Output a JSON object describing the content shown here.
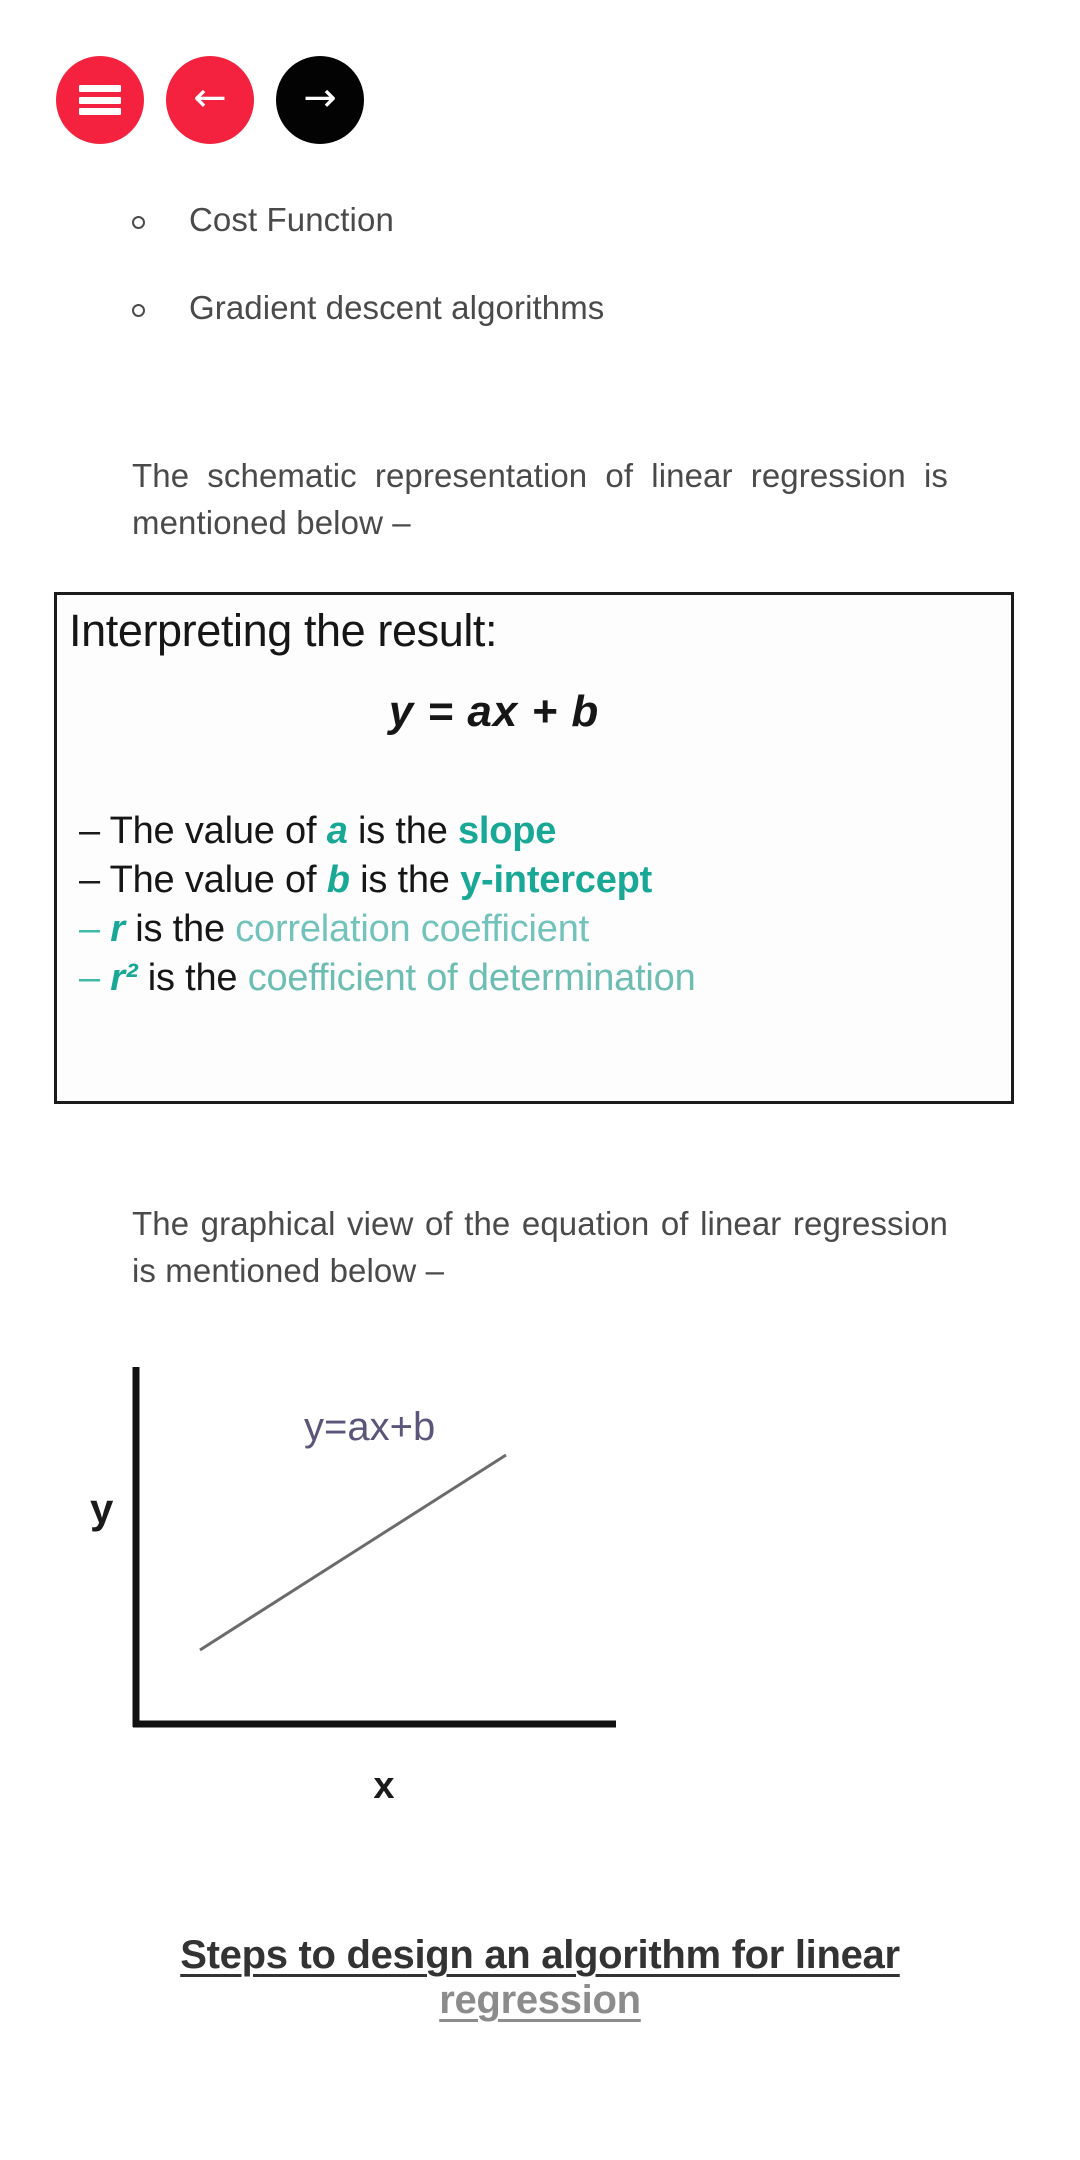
{
  "nav": {
    "buttons": [
      {
        "name": "menu-button",
        "icon": "hamburger-icon",
        "label": "",
        "color": "#f4213f"
      },
      {
        "name": "back-button",
        "icon": "arrow-left-icon",
        "label": "←",
        "color": "#f4213f"
      },
      {
        "name": "forward-button",
        "icon": "arrow-right-icon",
        "label": "→",
        "color": "#030303"
      }
    ]
  },
  "list": {
    "items": [
      {
        "text": "Cost Function"
      },
      {
        "text": "Gradient descent algorithms"
      }
    ]
  },
  "paragraphs": {
    "schematic": {
      "line1": "The schematic representation of linear",
      "line2": "regression is mentioned below –"
    },
    "graphical": {
      "line1": "The graphical view of the equation of linear",
      "line2": "regression is mentioned below –"
    }
  },
  "figure_interpreting": {
    "title": "Interpreting the result:",
    "equation": "y = ax + b",
    "lines": [
      {
        "dash": "–",
        "pre": "The value of ",
        "var": "a",
        "mid": " is the ",
        "emph": "slope",
        "emph_style": "strong"
      },
      {
        "dash": "–",
        "pre": "The value of ",
        "var": "b",
        "mid": " is the ",
        "emph": "y-intercept",
        "emph_style": "strong"
      },
      {
        "dash": "–",
        "pre": "",
        "var": "r",
        "mid": " is the ",
        "emph": "correlation coefficient",
        "emph_style": "soft"
      },
      {
        "dash": "–",
        "pre": "",
        "var": "r²",
        "mid": " is the ",
        "emph": "coefficient of determination",
        "emph_style": "soft"
      }
    ],
    "colors": {
      "teal_strong": "#1aa896",
      "teal_soft": "#73c2bb",
      "text": "#161616",
      "border": "#1b1b1b"
    }
  },
  "figure_graph": {
    "y_axis_label": "y",
    "x_axis_label": "x",
    "annotation": "y=ax+b",
    "annotation_color": "#5b557a",
    "axis_color": "#111111",
    "line_color": "#6b6b6b"
  },
  "chart_data": {
    "type": "line",
    "title": "",
    "xlabel": "x",
    "ylabel": "y",
    "annotations": [
      "y=ax+b"
    ],
    "series": [
      {
        "name": "y=ax+b",
        "x": [
          0.18,
          0.95
        ],
        "y": [
          0.18,
          0.82
        ]
      }
    ],
    "xlim": [
      0,
      1
    ],
    "ylim": [
      0,
      1
    ],
    "grid": false,
    "legend": "none"
  },
  "section_heading": {
    "line1": "Steps to design an algorithm for linear",
    "line2": "regression"
  }
}
